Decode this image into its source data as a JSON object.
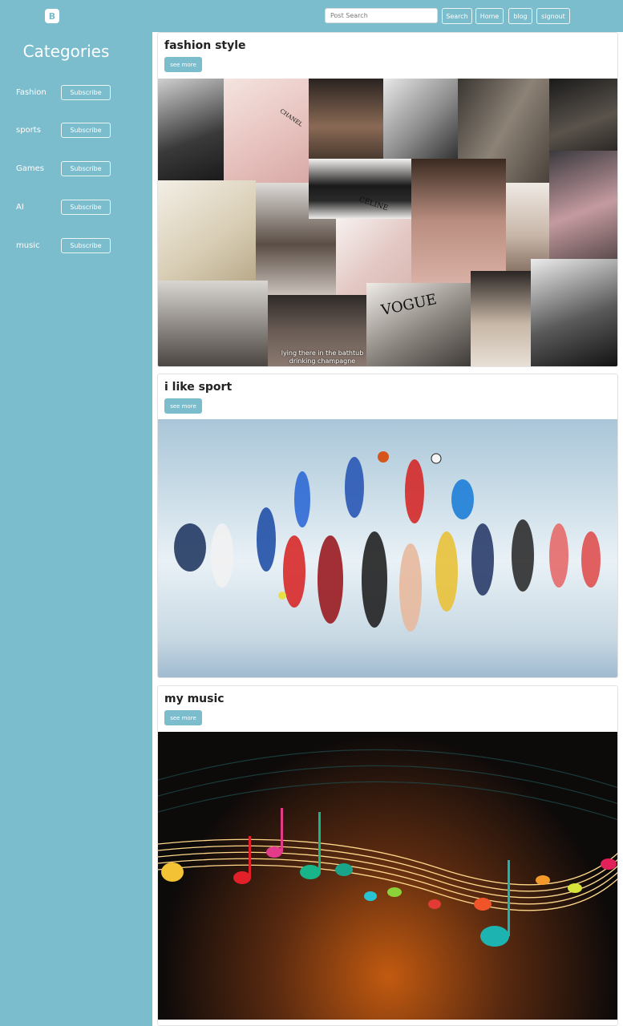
{
  "navbar": {
    "brand_letter": "B",
    "search_placeholder": "Post Search",
    "buttons": {
      "search": "Search",
      "home": "Home",
      "blog": "blog",
      "signout": "signout"
    }
  },
  "sidebar": {
    "title": "Categories",
    "subscribe_label": "Subscribe",
    "categories": [
      {
        "label": "Fashion"
      },
      {
        "label": "sports"
      },
      {
        "label": "Games"
      },
      {
        "label": "AI"
      },
      {
        "label": "music"
      }
    ]
  },
  "posts": [
    {
      "title": "fashion style",
      "button": "see more",
      "image": "fashion-collage",
      "caption_line1": "lying there in the bathtub",
      "caption_line2": "drinking champagne",
      "collage_words": {
        "chanel": "CHANEL",
        "celine": "CELINE",
        "vogue": "VOGUE"
      }
    },
    {
      "title": "i like sport",
      "button": "see more",
      "image": "athletes-montage"
    },
    {
      "title": "my music",
      "button": "see more",
      "image": "music-notes-staff"
    }
  ],
  "colors": {
    "accent": "#7bbdcc",
    "card_border": "#e2e2e2",
    "background": "#ffffff"
  }
}
